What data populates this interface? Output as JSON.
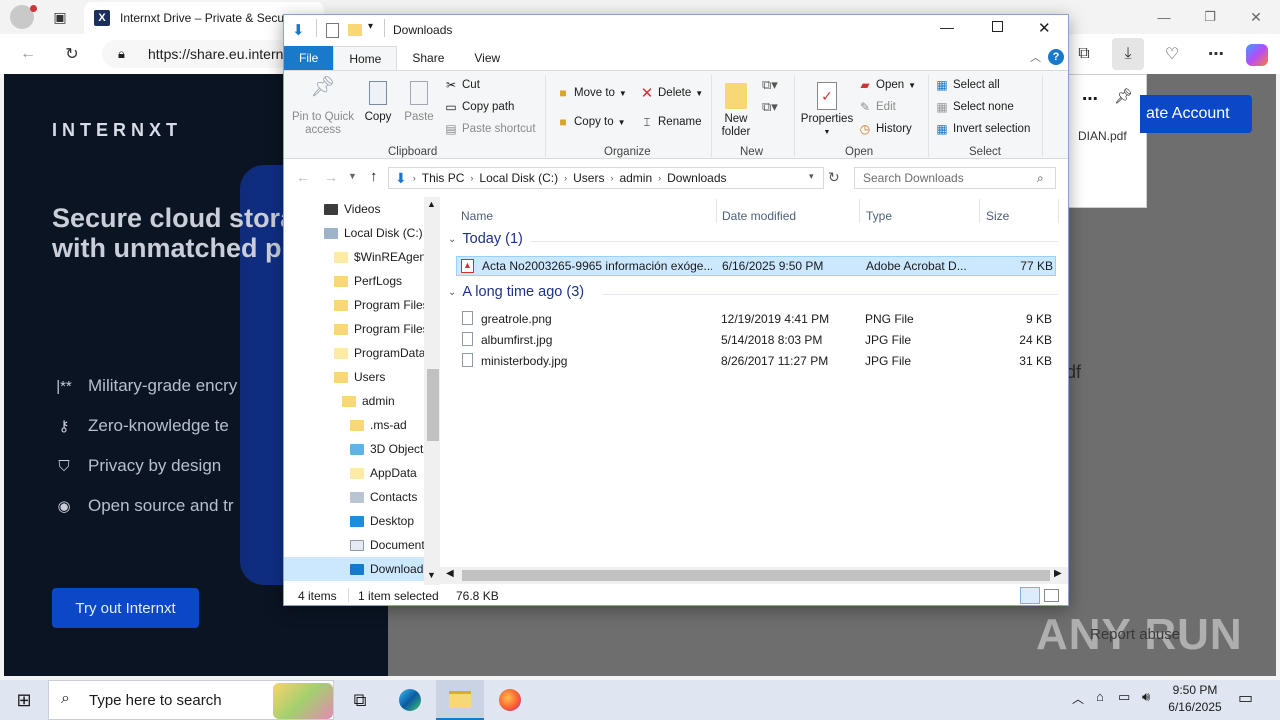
{
  "browser": {
    "tab_title": "Internxt Drive – Private & Secure",
    "tab_favicon": "X",
    "address": "https://share.eu.intern",
    "window_buttons": {
      "minimize": "—",
      "restore": "❐",
      "close": "✕"
    }
  },
  "page": {
    "brand": "INTERNXT",
    "hero": "Secure cloud storage with unmatched p",
    "features": [
      {
        "icon": "asterisk-icon",
        "glyph": "|**",
        "label": "Military-grade encry"
      },
      {
        "icon": "key-icon",
        "glyph": "⚷",
        "label": "Zero-knowledge te"
      },
      {
        "icon": "shield-check-icon",
        "glyph": "⛉",
        "label": "Privacy by design"
      },
      {
        "icon": "eye-icon",
        "glyph": "◉",
        "label": "Open source and tr"
      }
    ],
    "try_button": "Try out Internxt",
    "create_button": "ate Account",
    "popup_filename": "DIAN.pdf",
    "right_fragment": "df",
    "report": "Report abuse",
    "watermark": "ANY RUN"
  },
  "explorer": {
    "title": "Downloads",
    "ribbon_tabs": [
      "File",
      "Home",
      "Share",
      "View"
    ],
    "active_tab": "Home",
    "clipboard": {
      "pin": "Pin to Quick access",
      "copy": "Copy",
      "paste": "Paste",
      "cut": "Cut",
      "copy_path": "Copy path",
      "paste_shortcut": "Paste shortcut",
      "label": "Clipboard"
    },
    "organize": {
      "move_to": "Move to",
      "copy_to": "Copy to",
      "delete": "Delete",
      "rename": "Rename",
      "label": "Organize"
    },
    "new": {
      "new_folder": "New folder",
      "label": "New"
    },
    "open": {
      "properties": "Properties",
      "open": "Open",
      "edit": "Edit",
      "history": "History",
      "label": "Open"
    },
    "select": {
      "select_all": "Select all",
      "select_none": "Select none",
      "invert": "Invert selection",
      "label": "Select"
    },
    "breadcrumb": [
      "This PC",
      "Local Disk (C:)",
      "Users",
      "admin",
      "Downloads"
    ],
    "search_placeholder": "Search Downloads",
    "nav_items": [
      {
        "label": "Videos",
        "icon": "video-icon"
      },
      {
        "label": "Local Disk (C:)",
        "icon": "drive-icon"
      },
      {
        "label": "$WinREAgent",
        "icon": "folder-icon"
      },
      {
        "label": "PerfLogs",
        "icon": "folder-icon"
      },
      {
        "label": "Program Files",
        "icon": "folder-icon"
      },
      {
        "label": "Program Files",
        "icon": "folder-icon"
      },
      {
        "label": "ProgramData",
        "icon": "folder-icon"
      },
      {
        "label": "Users",
        "icon": "folder-icon"
      },
      {
        "label": "admin",
        "icon": "folder-icon"
      },
      {
        "label": ".ms-ad",
        "icon": "folder-icon"
      },
      {
        "label": "3D Objects",
        "icon": "3d-objects-icon"
      },
      {
        "label": "AppData",
        "icon": "folder-icon"
      },
      {
        "label": "Contacts",
        "icon": "contacts-icon"
      },
      {
        "label": "Desktop",
        "icon": "desktop-icon"
      },
      {
        "label": "Document",
        "icon": "documents-icon"
      },
      {
        "label": "Download",
        "icon": "downloads-icon"
      }
    ],
    "columns": [
      "Name",
      "Date modified",
      "Type",
      "Size"
    ],
    "groups": [
      {
        "label": "Today (1)",
        "files": [
          {
            "name": "Acta No2003265-9965 información exóge...",
            "date": "6/16/2025 9:50 PM",
            "type": "Adobe Acrobat D...",
            "size": "77 KB",
            "icon": "pdf-icon"
          }
        ]
      },
      {
        "label": "A long time ago (3)",
        "files": [
          {
            "name": "greatrole.png",
            "date": "12/19/2019 4:41 PM",
            "type": "PNG File",
            "size": "9 KB",
            "icon": "image-file-icon"
          },
          {
            "name": "albumfirst.jpg",
            "date": "5/14/2018 8:03 PM",
            "type": "JPG File",
            "size": "24 KB",
            "icon": "image-file-icon"
          },
          {
            "name": "ministerbody.jpg",
            "date": "8/26/2017 11:27 PM",
            "type": "JPG File",
            "size": "31 KB",
            "icon": "image-file-icon"
          }
        ]
      }
    ],
    "status": {
      "count": "4 items",
      "selected": "1 item selected",
      "size": "76.8 KB"
    }
  },
  "taskbar": {
    "search_placeholder": "Type here to search",
    "time": "9:50 PM",
    "date": "6/16/2025"
  },
  "colors": {
    "accent": "#1979ca",
    "brand_blue": "#0b48c8",
    "selection": "#cce8ff"
  }
}
